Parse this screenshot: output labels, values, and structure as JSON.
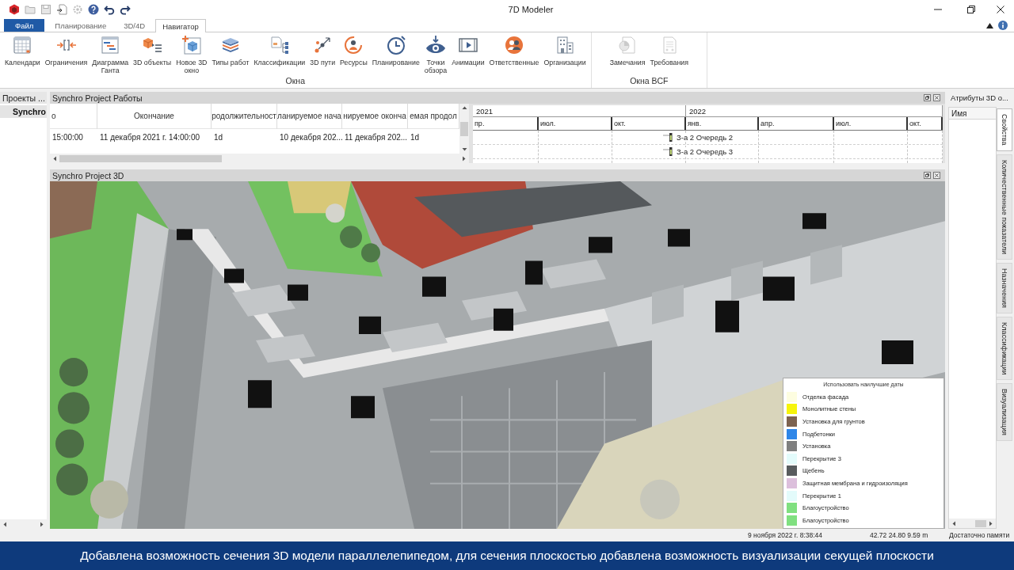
{
  "window": {
    "title": "7D Modeler"
  },
  "ribbon": {
    "tabs": [
      {
        "label": "Файл",
        "kind": "menu",
        "selected": false
      },
      {
        "label": "Планирование",
        "kind": "tab",
        "selected": false
      },
      {
        "label": "3D/4D",
        "kind": "tab",
        "selected": false
      },
      {
        "label": "Навигатор",
        "kind": "tab",
        "selected": true
      }
    ],
    "groups": [
      {
        "label": "Окна",
        "buttons": [
          {
            "label": "Календари",
            "disabled": false
          },
          {
            "label": "Ограничения",
            "disabled": false
          },
          {
            "label": "Диаграмма\nГанта",
            "disabled": false
          },
          {
            "label": "3D объекты",
            "disabled": false
          },
          {
            "label": "Новое 3D\nокно",
            "disabled": false
          },
          {
            "label": "Типы работ",
            "disabled": false
          },
          {
            "label": "Классификации",
            "disabled": false
          },
          {
            "label": "3D пути",
            "disabled": false
          },
          {
            "label": "Ресурсы",
            "disabled": false
          },
          {
            "label": "Планирование",
            "disabled": false
          },
          {
            "label": "Точки\nобзора",
            "disabled": false
          },
          {
            "label": "Анимации",
            "disabled": false
          },
          {
            "label": "Ответственные",
            "disabled": false
          },
          {
            "label": "Организации",
            "disabled": false
          }
        ]
      },
      {
        "label": "Окна BCF",
        "buttons": [
          {
            "label": "Замечания",
            "disabled": true
          },
          {
            "label": "Требования",
            "disabled": true
          }
        ]
      }
    ]
  },
  "projects_panel": {
    "title": "Проекты ...",
    "items": [
      {
        "label": "Synchro",
        "selected": true
      }
    ]
  },
  "works_panel": {
    "title": "Synchro Project Работы",
    "table": {
      "columns": [
        "о",
        "Окончание",
        "родолжительност",
        "ланируемое нача",
        "нируемое оконча",
        "емая продол"
      ],
      "rows": [
        [
          "15:00:00",
          "11 декабря 2021 г. 14:00:00",
          "1d",
          "10 декабря 202...",
          "11 декабря 202...",
          "1d"
        ]
      ]
    },
    "gantt": {
      "years": [
        "2021",
        "2022"
      ],
      "months": [
        "пр.",
        "июл.",
        "окт.",
        "янв.",
        "апр.",
        "июл.",
        "окт."
      ],
      "tasks": [
        {
          "label": "З-а 2 Очередь 2"
        },
        {
          "label": "З-а 2 Очередь 3"
        }
      ]
    }
  },
  "view_3d_panel": {
    "title": "Synchro Project 3D",
    "legend": {
      "title": "Использовать наилучшие даты",
      "items": [
        {
          "label": "Отделка фасада",
          "color": "#fdfde0"
        },
        {
          "label": "Монолитные стены",
          "color": "#f6f40a"
        },
        {
          "label": "Установка для грунтов",
          "color": "#7d6350"
        },
        {
          "label": "Подбетонки",
          "color": "#2e86e8"
        },
        {
          "label": "Установка",
          "color": "#7f7f7f"
        },
        {
          "label": "Перекрытие 3",
          "color": "#e3fbfb"
        },
        {
          "label": "Щебень",
          "color": "#585c5e"
        },
        {
          "label": "Защитная мембрана и гидроизоляция",
          "color": "#dcbfdc"
        },
        {
          "label": "Перекрытие 1",
          "color": "#e3fbfb"
        },
        {
          "label": "Благоустройство",
          "color": "#80e080"
        },
        {
          "label": "Благоустройство",
          "color": "#80e080"
        }
      ]
    }
  },
  "attributes_panel": {
    "title": "Атрибуты 3D о...",
    "columns": [
      "Имя"
    ],
    "side_tabs": [
      {
        "label": "Свойства",
        "selected": true
      },
      {
        "label": "Количественные показатели",
        "selected": false
      },
      {
        "label": "Назначения",
        "selected": false
      },
      {
        "label": "Классификации",
        "selected": false
      },
      {
        "label": "Визуализация",
        "selected": false
      }
    ]
  },
  "status_bar": {
    "date": "9 ноября 2022 г. 8:38:44",
    "coordinates": "42.72 24.80 9.59 m",
    "memory": "Достаточно памяти"
  },
  "caption": "Добавлена возможность сечения 3D модели параллелепипедом, для сечения плоскостью добавлена возможность визуализации секущей плоскости"
}
